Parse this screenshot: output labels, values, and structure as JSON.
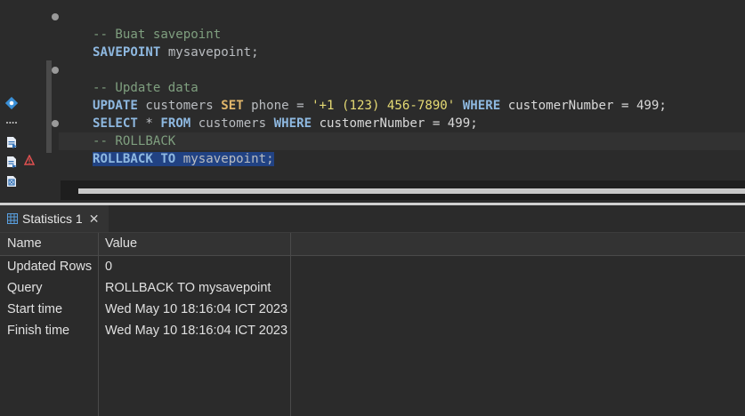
{
  "editor": {
    "lines": {
      "comment_savepoint": "-- Buat savepoint",
      "savepoint_kw": "SAVEPOINT",
      "savepoint_name": " mysavepoint;",
      "comment_update": "-- Update data",
      "update_kw": "UPDATE",
      "update_table": " customers ",
      "set_kw": "SET",
      "update_col": " phone = ",
      "update_val": "'+1 (123) 456-7890'",
      "where_kw": "WHERE",
      "update_cond": " customerNumber = 499;",
      "select_kw": "SELECT",
      "select_star": " * ",
      "from_kw": "FROM",
      "select_table": " customers ",
      "select_where_kw": "WHERE",
      "select_cond": " customerNumber = 499;",
      "comment_rollback": "-- ROLLBACK",
      "rollback_kw": "ROLLBACK TO",
      "rollback_name": " mysavepoint;"
    }
  },
  "stats": {
    "tab_label": "Statistics 1",
    "close_glyph": "✕",
    "columns": [
      "Name",
      "Value"
    ],
    "rows": [
      {
        "name": "Updated Rows",
        "value": "0"
      },
      {
        "name": "Query",
        "value": "ROLLBACK TO mysavepoint"
      },
      {
        "name": "Start time",
        "value": "Wed May 10 18:16:04 ICT 2023"
      },
      {
        "name": "Finish time",
        "value": "Wed May 10 18:16:04 ICT 2023"
      }
    ]
  },
  "gutter_icons": [
    "settings-icon",
    "more-icon",
    "script-icon",
    "script-warning-icon",
    "warning-icon",
    "explain-icon"
  ]
}
